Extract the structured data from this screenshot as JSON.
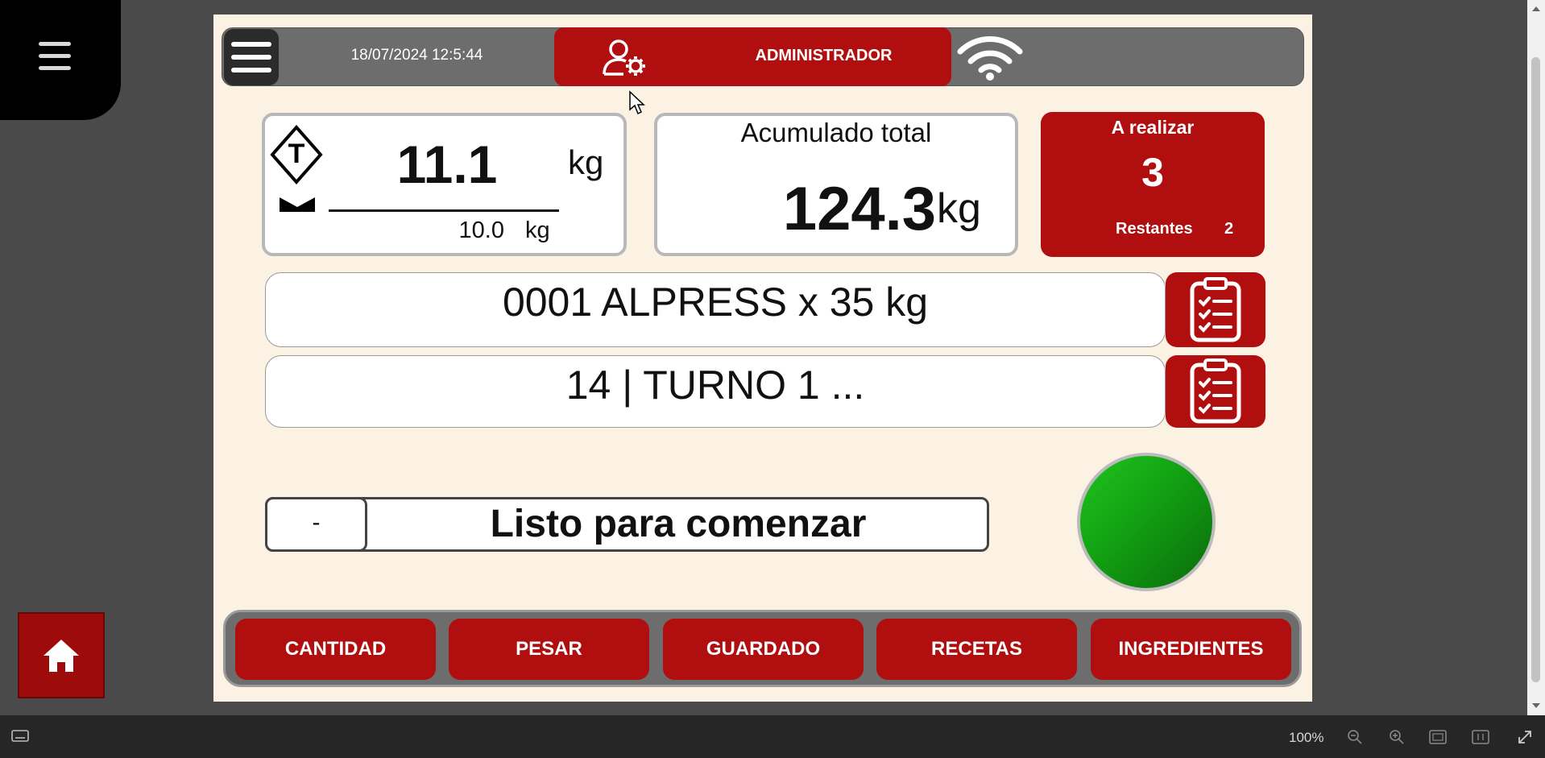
{
  "header": {
    "datetime": "18/07/2024 12:5:44",
    "user_role": "ADMINISTRADOR"
  },
  "scale": {
    "weight_value": "11.1",
    "weight_unit": "kg",
    "tare_value": "10.0",
    "tare_unit": "kg",
    "tare_symbol": "T"
  },
  "accumulated": {
    "title": "Acumulado total",
    "value": "124.3",
    "unit": "kg"
  },
  "pending": {
    "title": "A realizar",
    "count": "3",
    "remaining_label": "Restantes",
    "remaining_value": "2"
  },
  "recipe": {
    "text": "0001 ALPRESS x 35 kg"
  },
  "shift": {
    "text": "14 | TURNO 1 ..."
  },
  "status": {
    "prefix": "-",
    "message": "Listo para comenzar"
  },
  "nav": {
    "quantity": "CANTIDAD",
    "weigh": "PESAR",
    "saved": "GUARDADO",
    "recipes": "RECETAS",
    "ingredients": "INGREDIENTES"
  },
  "viewer": {
    "zoom": "100%"
  },
  "colors": {
    "accent": "#b10f0f",
    "background": "#fbf2e4",
    "bar": "#6d6d6d",
    "led": "#12a012"
  }
}
